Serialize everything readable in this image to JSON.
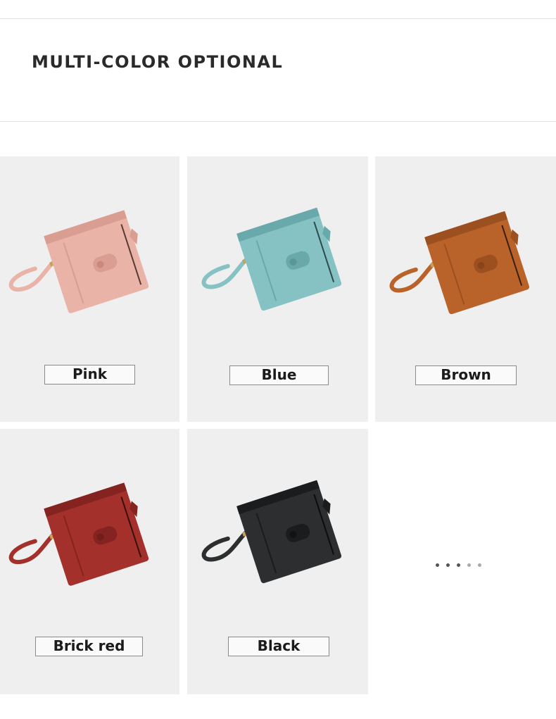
{
  "header": {
    "title": "MULTI-COLOR OPTIONAL"
  },
  "swatches": [
    {
      "label": "Pink",
      "color": "#e9b3a8",
      "shade": "#d99d91"
    },
    {
      "label": "Blue",
      "color": "#86c2c4",
      "shade": "#6aa9ab"
    },
    {
      "label": "Brown",
      "color": "#b9632a",
      "shade": "#9c501f"
    },
    {
      "label": "Brick red",
      "color": "#a3302a",
      "shade": "#84231f"
    },
    {
      "label": "Black",
      "color": "#2c2e30",
      "shade": "#1b1c1d"
    }
  ],
  "carousel": {
    "page_count": 5,
    "active_index": 0
  }
}
